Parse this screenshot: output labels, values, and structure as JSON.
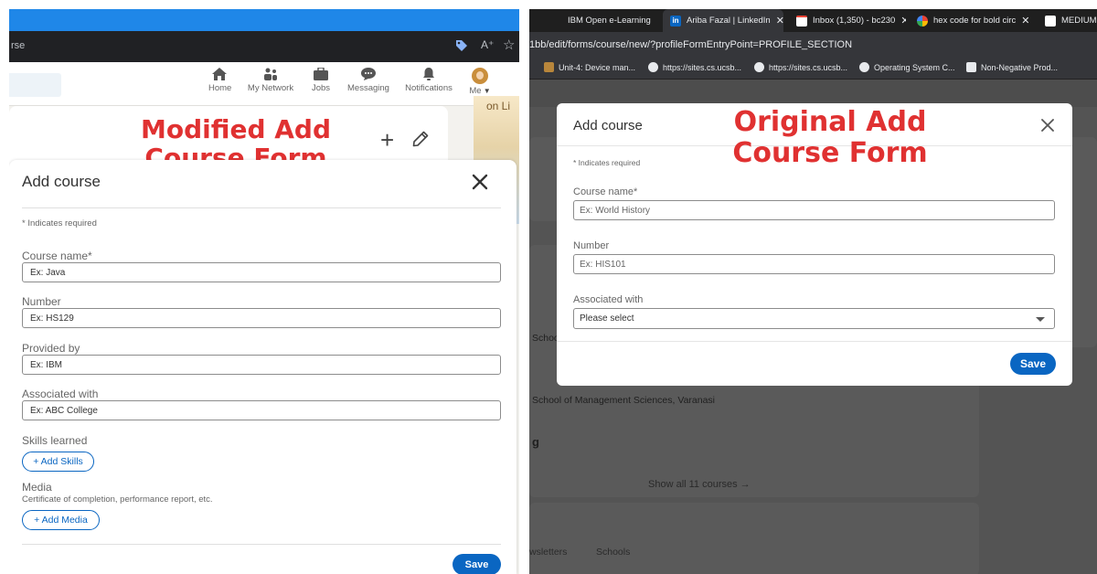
{
  "left": {
    "browser": {
      "url_fragment": "rse"
    },
    "nav": {
      "items": [
        {
          "label": "Home",
          "icon": "home-icon"
        },
        {
          "label": "My Network",
          "icon": "my-network-icon"
        },
        {
          "label": "Jobs",
          "icon": "jobs-icon"
        },
        {
          "label": "Messaging",
          "icon": "messaging-icon"
        },
        {
          "label": "Notifications",
          "icon": "notifications-icon"
        },
        {
          "label": "Me",
          "icon": "me-avatar"
        }
      ]
    },
    "side_image_text": "on Li",
    "annotation_title": "Modified Add Course Form",
    "modal": {
      "title": "Add course",
      "required_note": "* Indicates required",
      "course_name_label": "Course name*",
      "course_name_placeholder": "Ex: Java",
      "number_label": "Number",
      "number_placeholder": "Ex: HS129",
      "provided_by_label": "Provided by",
      "provided_by_placeholder": "Ex: IBM",
      "associated_label": "Associated with",
      "associated_placeholder": "Ex: ABC College",
      "skills_label": "Skills learned",
      "add_skills": "+ Add Skills",
      "media_label": "Media",
      "media_hint": "Certificate of completion, performance report, etc.",
      "add_media": "+ Add Media",
      "save": "Save"
    }
  },
  "right": {
    "tabs": [
      {
        "title": "IBM Open e-Learning"
      },
      {
        "title": "Ariba Fazal | LinkedIn"
      },
      {
        "title": "Inbox (1,350) - bc230"
      },
      {
        "title": "hex code for bold circ"
      },
      {
        "title": "MEDIUM"
      }
    ],
    "url": "1bb/edit/forms/course/new/?profileFormEntryPoint=PROFILE_SECTION",
    "bookmarks": [
      "Unit-4: Device man...",
      "https://sites.cs.ucsb...",
      "https://sites.cs.ucsb...",
      "Operating System C...",
      "Non-Negative Prod..."
    ],
    "background": {
      "text_school": "Schoo",
      "text_school_full": "School of Management Sciences, Varanasi",
      "text_g": "g",
      "show_all": "Show all 11 courses →",
      "tab_newsletters": "wsletters",
      "tab_schools": "Schools"
    },
    "annotation_title": "Original Add Course Form",
    "modal": {
      "title": "Add course",
      "required_note": "* Indicates required",
      "course_name_label": "Course name*",
      "course_name_placeholder": "Ex: World History",
      "number_label": "Number",
      "number_placeholder": "Ex: HIS101",
      "associated_label": "Associated with",
      "associated_value": "Please select",
      "save": "Save"
    }
  },
  "colors": {
    "annotation_red": "#e03131",
    "linkedin_blue": "#0a66c2"
  }
}
